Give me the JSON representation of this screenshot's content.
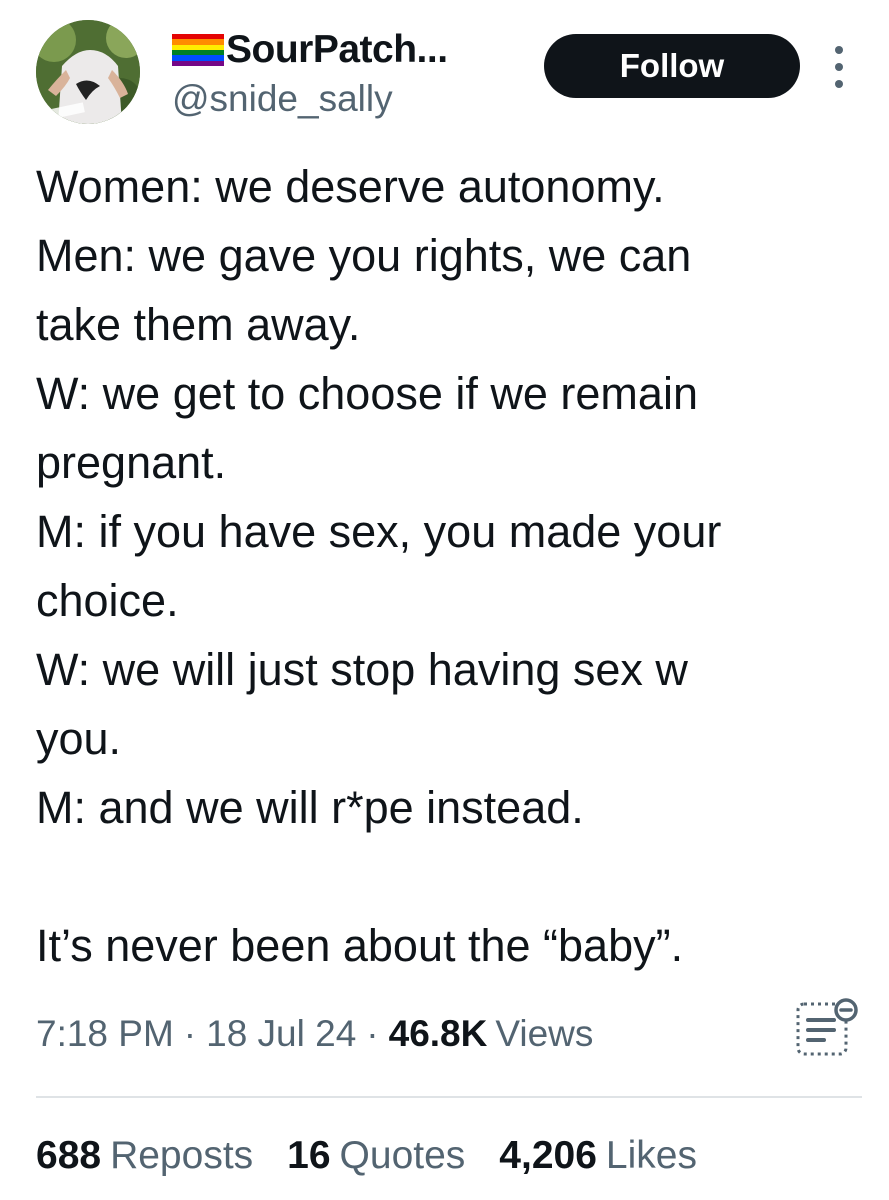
{
  "author": {
    "display_name": "SourPatch...",
    "handle": "@snide_sally"
  },
  "follow_label": "Follow",
  "colors": {
    "follow_bg": "#0f1419",
    "secondary_text": "#536471",
    "pride_flag": [
      "#e40303",
      "#ff8c00",
      "#ffed00",
      "#008026",
      "#004dff",
      "#750787"
    ]
  },
  "icons": [
    "more-icon",
    "analytics-icon",
    "pride-flag-icon"
  ],
  "tweet_lines": [
    "Women: we deserve autonomy.",
    "Men: we gave you rights, we can",
    "take them away.",
    "W: we get to choose if we remain",
    "pregnant.",
    "M: if you have sex, you made your",
    "choice.",
    "W: we will just stop having sex w",
    "you.",
    "M: and we will r*pe instead.",
    "",
    "It’s never been about the “baby”."
  ],
  "meta": {
    "time": "7:18 PM",
    "date": "18 Jul 24",
    "views_count": "46.8K",
    "views_label": "Views"
  },
  "stats": {
    "reposts_count": "688",
    "reposts_label": "Reposts",
    "quotes_count": "16",
    "quotes_label": "Quotes",
    "likes_count": "4,206",
    "likes_label": "Likes"
  }
}
